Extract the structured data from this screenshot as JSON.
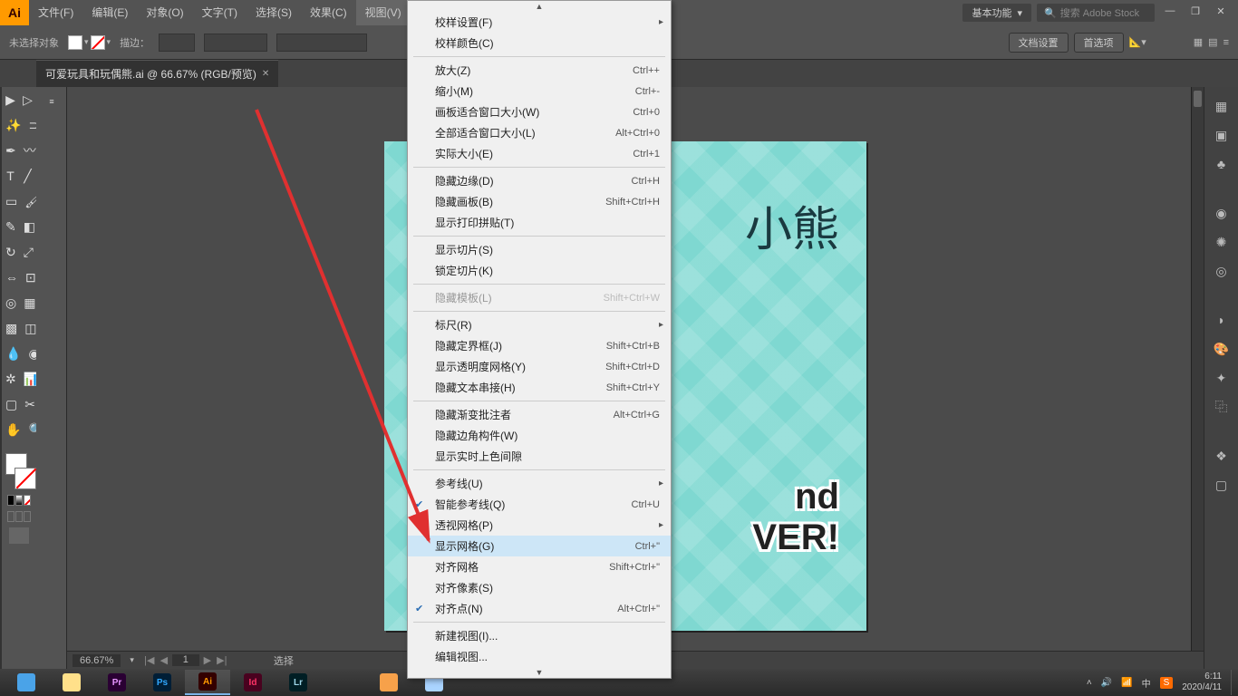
{
  "app": {
    "icon_text": "Ai"
  },
  "menubar": [
    "文件(F)",
    "编辑(E)",
    "对象(O)",
    "文字(T)",
    "选择(S)",
    "效果(C)",
    "视图(V)"
  ],
  "active_menu_index": 6,
  "workspace": "基本功能",
  "search_placeholder": "搜索 Adobe Stock",
  "controlbar": {
    "selection": "未选择对象",
    "stroke_label": "描边：",
    "doc_setup": "文档设置",
    "prefs": "首选项"
  },
  "tab": {
    "name": "可爱玩具和玩偶熊.ai @ 66.67% (RGB/预览)"
  },
  "canvas": {
    "title_top": "小熊",
    "title_mid1": "nd",
    "title_mid2": "VER!"
  },
  "status": {
    "zoom": "66.67%",
    "page": "1",
    "tool": "选择"
  },
  "dropdown": {
    "groups": [
      [
        {
          "label": "校样设置(F)",
          "sub": true
        },
        {
          "label": "校样颜色(C)"
        }
      ],
      [
        {
          "label": "放大(Z)",
          "short": "Ctrl++"
        },
        {
          "label": "缩小(M)",
          "short": "Ctrl+-"
        },
        {
          "label": "画板适合窗口大小(W)",
          "short": "Ctrl+0"
        },
        {
          "label": "全部适合窗口大小(L)",
          "short": "Alt+Ctrl+0"
        },
        {
          "label": "实际大小(E)",
          "short": "Ctrl+1"
        }
      ],
      [
        {
          "label": "隐藏边缘(D)",
          "short": "Ctrl+H"
        },
        {
          "label": "隐藏画板(B)",
          "short": "Shift+Ctrl+H"
        },
        {
          "label": "显示打印拼贴(T)"
        }
      ],
      [
        {
          "label": "显示切片(S)"
        },
        {
          "label": "锁定切片(K)"
        }
      ],
      [
        {
          "label": "隐藏模板(L)",
          "short": "Shift+Ctrl+W",
          "disabled": true
        }
      ],
      [
        {
          "label": "标尺(R)",
          "sub": true
        },
        {
          "label": "隐藏定界框(J)",
          "short": "Shift+Ctrl+B"
        },
        {
          "label": "显示透明度网格(Y)",
          "short": "Shift+Ctrl+D"
        },
        {
          "label": "隐藏文本串接(H)",
          "short": "Shift+Ctrl+Y"
        }
      ],
      [
        {
          "label": "隐藏渐变批注者",
          "short": "Alt+Ctrl+G"
        },
        {
          "label": "隐藏边角构件(W)"
        },
        {
          "label": "显示实时上色间隙"
        }
      ],
      [
        {
          "label": "参考线(U)",
          "sub": true
        },
        {
          "label": "智能参考线(Q)",
          "short": "Ctrl+U",
          "check": true
        },
        {
          "label": "透视网格(P)",
          "sub": true
        },
        {
          "label": "显示网格(G)",
          "short": "Ctrl+\"",
          "highlight": true
        },
        {
          "label": "对齐网格",
          "short": "Shift+Ctrl+\""
        },
        {
          "label": "对齐像素(S)"
        },
        {
          "label": "对齐点(N)",
          "short": "Alt+Ctrl+\"",
          "check": true
        }
      ],
      [
        {
          "label": "新建视图(I)..."
        },
        {
          "label": "编辑视图..."
        }
      ]
    ]
  },
  "taskbar": {
    "apps": [
      {
        "bg": "#4aa3e8",
        "txt": "",
        "name": "browser-icon"
      },
      {
        "bg": "#ffe08a",
        "txt": "",
        "name": "explorer-icon"
      },
      {
        "bg": "#2a0033",
        "txt": "Pr",
        "color": "#e696ff",
        "name": "premiere-icon"
      },
      {
        "bg": "#001e36",
        "txt": "Ps",
        "color": "#31a8ff",
        "name": "photoshop-icon"
      },
      {
        "bg": "#330000",
        "txt": "Ai",
        "color": "#ff9a00",
        "active": true,
        "name": "illustrator-icon"
      },
      {
        "bg": "#49021f",
        "txt": "Id",
        "color": "#ff3366",
        "name": "indesign-icon"
      },
      {
        "bg": "#001e24",
        "txt": "Lr",
        "color": "#9dd6e8",
        "name": "lightroom-icon"
      }
    ],
    "clock": {
      "time": "6:11",
      "date": "2020/4/11"
    }
  }
}
